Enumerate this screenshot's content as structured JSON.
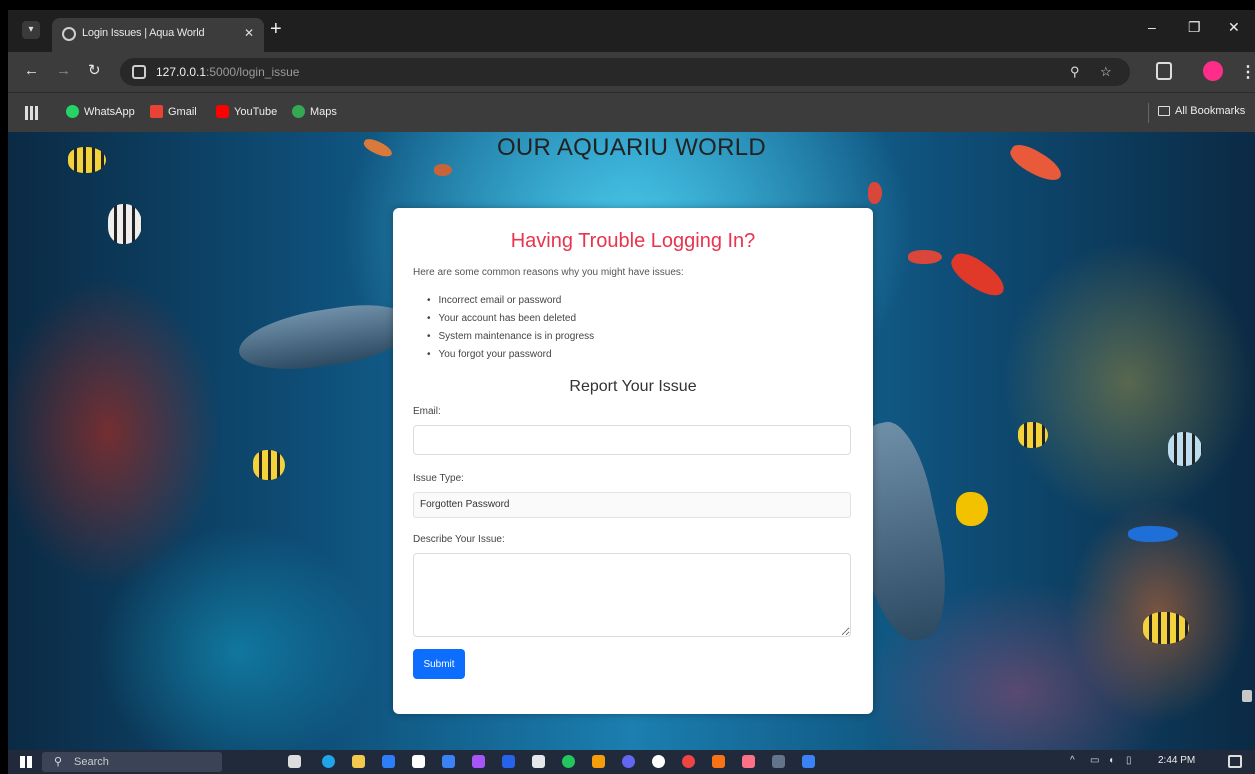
{
  "browser": {
    "tab_title": "Login Issues | Aqua World",
    "tab_close": "✕",
    "new_tab": "+",
    "url_host": "127.0.0.1",
    "url_path": ":5000/login_issue",
    "window_controls": {
      "minimize": "–",
      "restore": "❐",
      "close": "✕"
    },
    "bookmarks": [
      {
        "label": "WhatsApp",
        "color": "#25d366"
      },
      {
        "label": "Gmail",
        "color": "#ea4335"
      },
      {
        "label": "YouTube",
        "color": "#ff0000"
      },
      {
        "label": "Maps",
        "color": "#34a853"
      }
    ],
    "all_bookmarks": "All Bookmarks"
  },
  "page": {
    "site_title": "OUR AQUARIU WORLD",
    "heading": "Having Trouble Logging In?",
    "intro": "Here are some common reasons why you might have issues:",
    "reasons": [
      "Incorrect email or password",
      "Your account has been deleted",
      "System maintenance is in progress",
      "You forgot your password"
    ],
    "report_heading": "Report Your Issue",
    "email_label": "Email:",
    "email_value": "",
    "issue_type_label": "Issue Type:",
    "issue_type_value": "Forgotten Password",
    "describe_label": "Describe Your Issue:",
    "describe_value": "",
    "submit_label": "Submit"
  },
  "taskbar": {
    "search_placeholder": "Search",
    "clock": "2:44 PM",
    "accent": "#0d6efd"
  },
  "colors": {
    "heading": "#e8344e",
    "submit_button": "#0d6efd"
  }
}
